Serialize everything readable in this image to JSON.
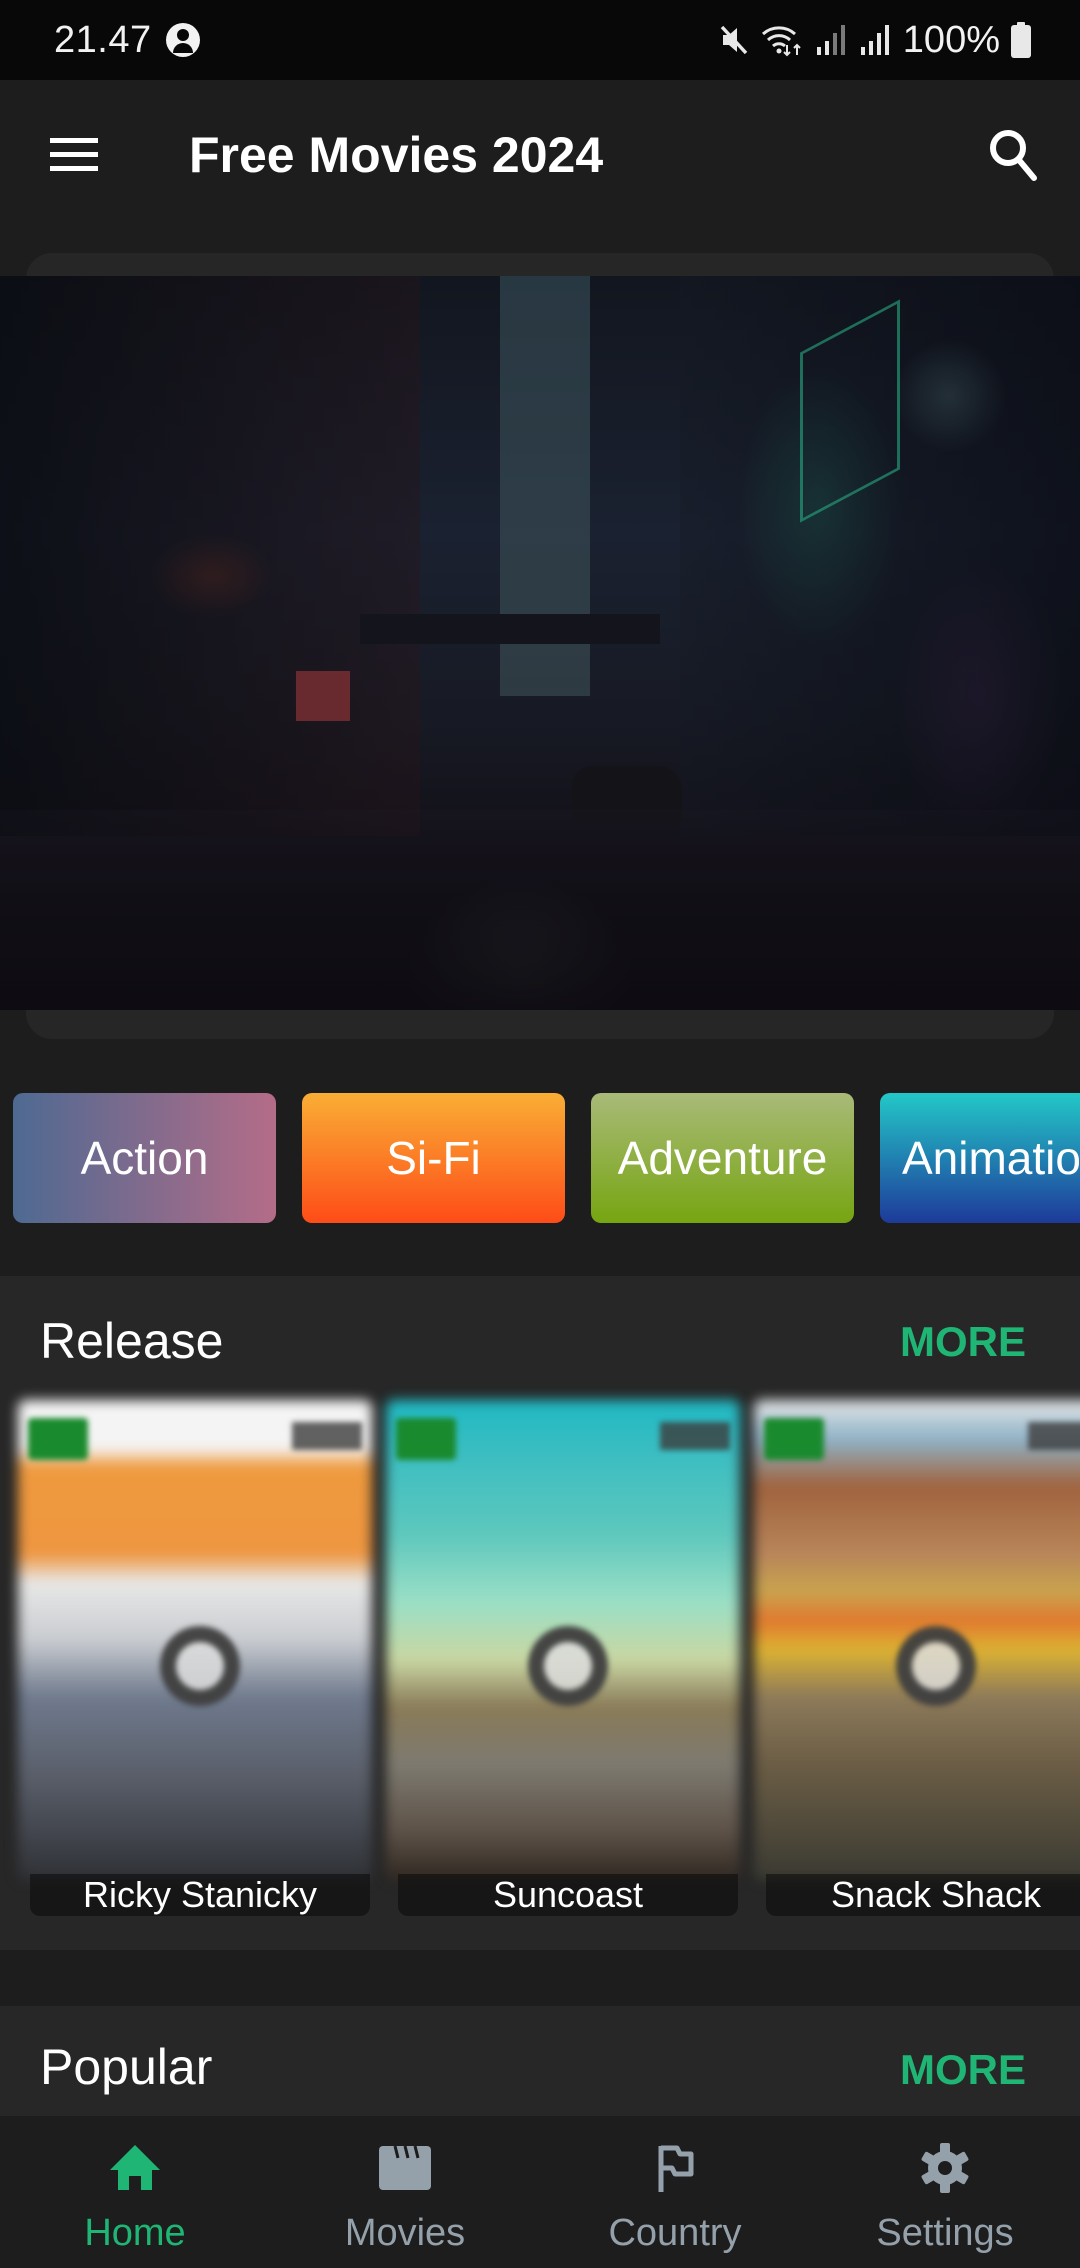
{
  "status_bar": {
    "time": "21.47",
    "battery": "100%",
    "icons": [
      "account-circle-icon",
      "mute-icon",
      "wifi-icon",
      "signal-icon",
      "signal-icon",
      "battery-icon"
    ]
  },
  "app_bar": {
    "title": "Free Movies 2024",
    "menu_icon": "hamburger-menu-icon",
    "search_icon": "search-icon"
  },
  "banner": {
    "image": "dark-rainy-city-street"
  },
  "genres": [
    {
      "label": "Action",
      "gradient_from": "#4e6a92",
      "gradient_to": "#b46c88"
    },
    {
      "label": "Si-Fi",
      "gradient_from": "#f9ae35",
      "gradient_to": "#fe4c18"
    },
    {
      "label": "Adventure",
      "gradient_from": "#a9ba78",
      "gradient_to": "#76a511"
    },
    {
      "label": "Animation",
      "gradient_from": "#23c8c8",
      "gradient_to": "#1e3a9a"
    }
  ],
  "sections": {
    "release": {
      "title": "Release",
      "more": "MORE",
      "movies": [
        {
          "title": "Ricky Stanicky"
        },
        {
          "title": "Suncoast"
        },
        {
          "title": "Snack Shack"
        }
      ]
    },
    "popular": {
      "title": "Popular",
      "more": "MORE"
    }
  },
  "bottom_nav": {
    "active": "Home",
    "items": [
      {
        "label": "Home",
        "icon": "home-icon"
      },
      {
        "label": "Movies",
        "icon": "clapperboard-icon"
      },
      {
        "label": "Country",
        "icon": "flag-icon"
      },
      {
        "label": "Settings",
        "icon": "gear-icon"
      }
    ]
  },
  "colors": {
    "accent": "#1fb574",
    "inactive_nav": "#95a1aa",
    "background": "#1d1d1d",
    "panel": "#272727"
  }
}
